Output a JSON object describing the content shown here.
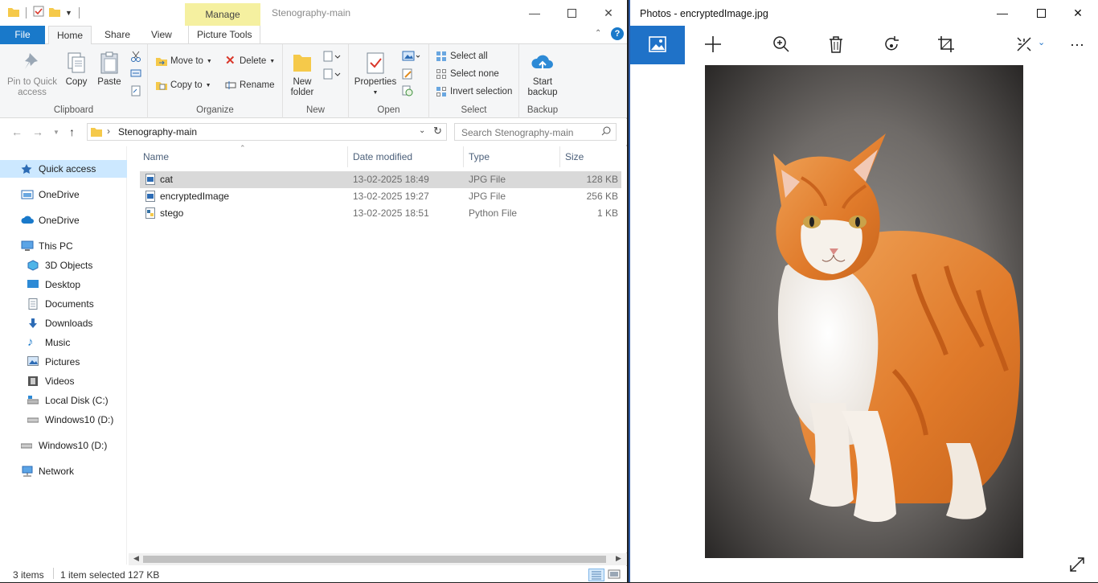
{
  "explorer": {
    "title": "Stenography-main",
    "contextual_tab": "Manage",
    "tabs": [
      "File",
      "Home",
      "Share",
      "View",
      "Picture Tools"
    ],
    "ribbon": {
      "clipboard": {
        "label": "Clipboard",
        "pin": "Pin to Quick access",
        "copy": "Copy",
        "paste": "Paste"
      },
      "organize": {
        "label": "Organize",
        "move_to": "Move to",
        "copy_to": "Copy to",
        "delete": "Delete",
        "rename": "Rename"
      },
      "new": {
        "label": "New",
        "new_folder": "New folder"
      },
      "open": {
        "label": "Open",
        "properties": "Properties"
      },
      "select": {
        "label": "Select",
        "select_all": "Select all",
        "select_none": "Select none",
        "invert": "Invert selection"
      },
      "backup": {
        "label": "Backup",
        "start_backup": "Start backup"
      }
    },
    "address": {
      "path": "Stenography-main",
      "search_placeholder": "Search Stenography-main"
    },
    "nav": {
      "quick_access": "Quick access",
      "onedrive1": "OneDrive",
      "onedrive2": "OneDrive",
      "this_pc": "This PC",
      "objects3d": "3D Objects",
      "desktop": "Desktop",
      "documents": "Documents",
      "downloads": "Downloads",
      "music": "Music",
      "pictures": "Pictures",
      "videos": "Videos",
      "local_disk": "Local Disk (C:)",
      "win10_sub": "Windows10 (D:)",
      "win10": "Windows10 (D:)",
      "network": "Network"
    },
    "columns": {
      "name": "Name",
      "date": "Date modified",
      "type": "Type",
      "size": "Size"
    },
    "files": [
      {
        "name": "cat",
        "date": "13-02-2025 18:49",
        "type": "JPG File",
        "size": "128 KB"
      },
      {
        "name": "encryptedImage",
        "date": "13-02-2025 19:27",
        "type": "JPG File",
        "size": "256 KB"
      },
      {
        "name": "stego",
        "date": "13-02-2025 18:51",
        "type": "Python File",
        "size": "1 KB"
      }
    ],
    "status": {
      "items": "3 items",
      "selected": "1 item selected",
      "size": "127 KB"
    }
  },
  "photos": {
    "title": "Photos - encryptedImage.jpg"
  },
  "colors": {
    "accent": "#1979ca",
    "manage_bg": "#f5f0a0",
    "selection": "#cce8ff",
    "photos_accent": "#1f72c8"
  }
}
